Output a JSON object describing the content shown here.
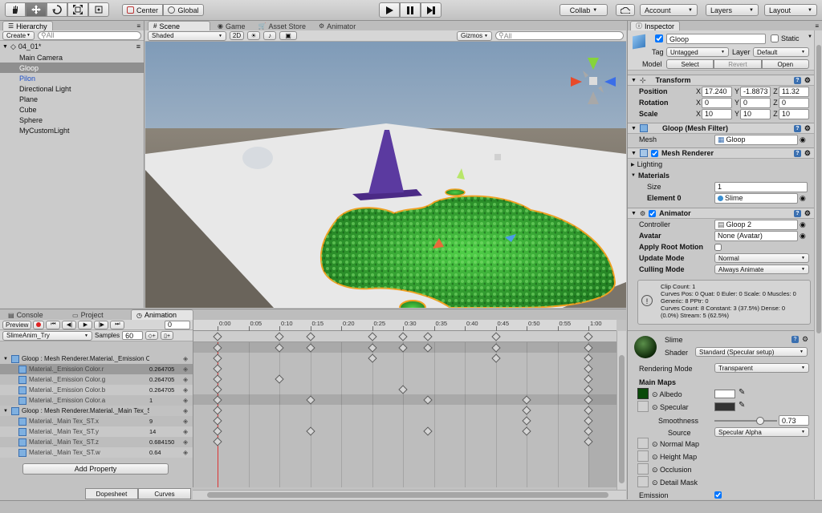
{
  "toolbar": {
    "pivot": "Center",
    "space": "Global",
    "collab": "Collab",
    "account": "Account",
    "layers": "Layers",
    "layout": "Layout"
  },
  "hierarchy": {
    "tab": "Hierarchy",
    "create": "Create",
    "search_placeholder": "All",
    "scene": "04_01*",
    "items": [
      "Main Camera",
      "Gloop",
      "Pilon",
      "Directional Light",
      "Plane",
      "Cube",
      "Sphere",
      "MyCustomLight"
    ]
  },
  "scene_tabs": [
    "Scene",
    "Game",
    "Asset Store",
    "Animator"
  ],
  "scene_bar": {
    "shading": "Shaded",
    "mode_2d": "2D",
    "gizmos": "Gizmos",
    "search_placeholder": "All"
  },
  "bottom_tabs": [
    "Console",
    "Project",
    "Animation"
  ],
  "animation": {
    "preview": "Preview",
    "frame": "0",
    "clip": "SlimeAnim_Try",
    "samples_label": "Samples",
    "samples": "60",
    "timeline_labels": [
      "0:00",
      "0:05",
      "0:10",
      "0:15",
      "0:20",
      "0:25",
      "0:30",
      "0:35",
      "0:40",
      "0:45",
      "0:50",
      "0:55",
      "1:00"
    ],
    "tracks": [
      {
        "name": "Gloop : Mesh Renderer.Material._Emission Colo",
        "value": "",
        "group": true
      },
      {
        "name": "Material._Emission Color.r",
        "value": "0.264705",
        "group": false
      },
      {
        "name": "Material._Emission Color.g",
        "value": "0.264705",
        "group": false
      },
      {
        "name": "Material._Emission Color.b",
        "value": "0.264705",
        "group": false
      },
      {
        "name": "Material._Emission Color.a",
        "value": "1",
        "group": false
      },
      {
        "name": "Gloop : Mesh Renderer.Material._Main Tex_ST",
        "value": "",
        "group": true
      },
      {
        "name": "Material._Main Tex_ST.x",
        "value": "9",
        "group": false
      },
      {
        "name": "Material._Main Tex_ST.y",
        "value": "14",
        "group": false
      },
      {
        "name": "Material._Main Tex_ST.z",
        "value": "0.684150",
        "group": false
      },
      {
        "name": "Material._Main Tex_ST.w",
        "value": "0.64",
        "group": false
      }
    ],
    "add_property": "Add Property",
    "dopesheet": "Dopesheet",
    "curves": "Curves"
  },
  "inspector": {
    "tab": "Inspector",
    "object_name": "Gloop",
    "static": "Static",
    "tag_label": "Tag",
    "tag": "Untagged",
    "layer_label": "Layer",
    "layer": "Default",
    "model_label": "Model",
    "select": "Select",
    "revert": "Revert",
    "open": "Open",
    "transform": {
      "title": "Transform",
      "position": "Position",
      "rotation": "Rotation",
      "scale": "Scale",
      "pos": [
        "17.240",
        "-1.8873",
        "11.32"
      ],
      "rot": [
        "0",
        "0",
        "0"
      ],
      "scl": [
        "10",
        "10",
        "10"
      ]
    },
    "mesh_filter": {
      "title": "Gloop (Mesh Filter)",
      "mesh_label": "Mesh",
      "mesh": "Gloop"
    },
    "mesh_renderer": {
      "title": "Mesh Renderer",
      "lighting": "Lighting",
      "materials": "Materials",
      "size_label": "Size",
      "size": "1",
      "element_label": "Element 0",
      "element": "Slime"
    },
    "animator": {
      "title": "Animator",
      "controller_label": "Controller",
      "controller": "Gloop 2",
      "avatar_label": "Avatar",
      "avatar": "None (Avatar)",
      "root_motion": "Apply Root Motion",
      "update_label": "Update Mode",
      "update": "Normal",
      "culling_label": "Culling Mode",
      "culling": "Always Animate",
      "info": [
        "Clip Count: 1",
        "Curves Pos: 0 Quat: 0 Euler: 0 Scale: 0 Muscles: 0",
        "Generic: 8 PPtr: 0",
        "Curves Count: 8 Constant: 3 (37.5%) Dense: 0",
        "(0.0%) Stream: 5 (62.5%)"
      ]
    },
    "material": {
      "name": "Slime",
      "shader_label": "Shader",
      "shader": "Standard (Specular setup)",
      "rendering_label": "Rendering Mode",
      "rendering": "Transparent",
      "main_maps": "Main Maps",
      "albedo": "Albedo",
      "specular": "Specular",
      "smoothness_label": "Smoothness",
      "smoothness": "0.73",
      "source_label": "Source",
      "source": "Specular Alpha",
      "normal_map": "Normal Map",
      "height_map": "Height Map",
      "occlusion": "Occlusion",
      "detail_mask": "Detail Mask",
      "emission": "Emission"
    }
  }
}
